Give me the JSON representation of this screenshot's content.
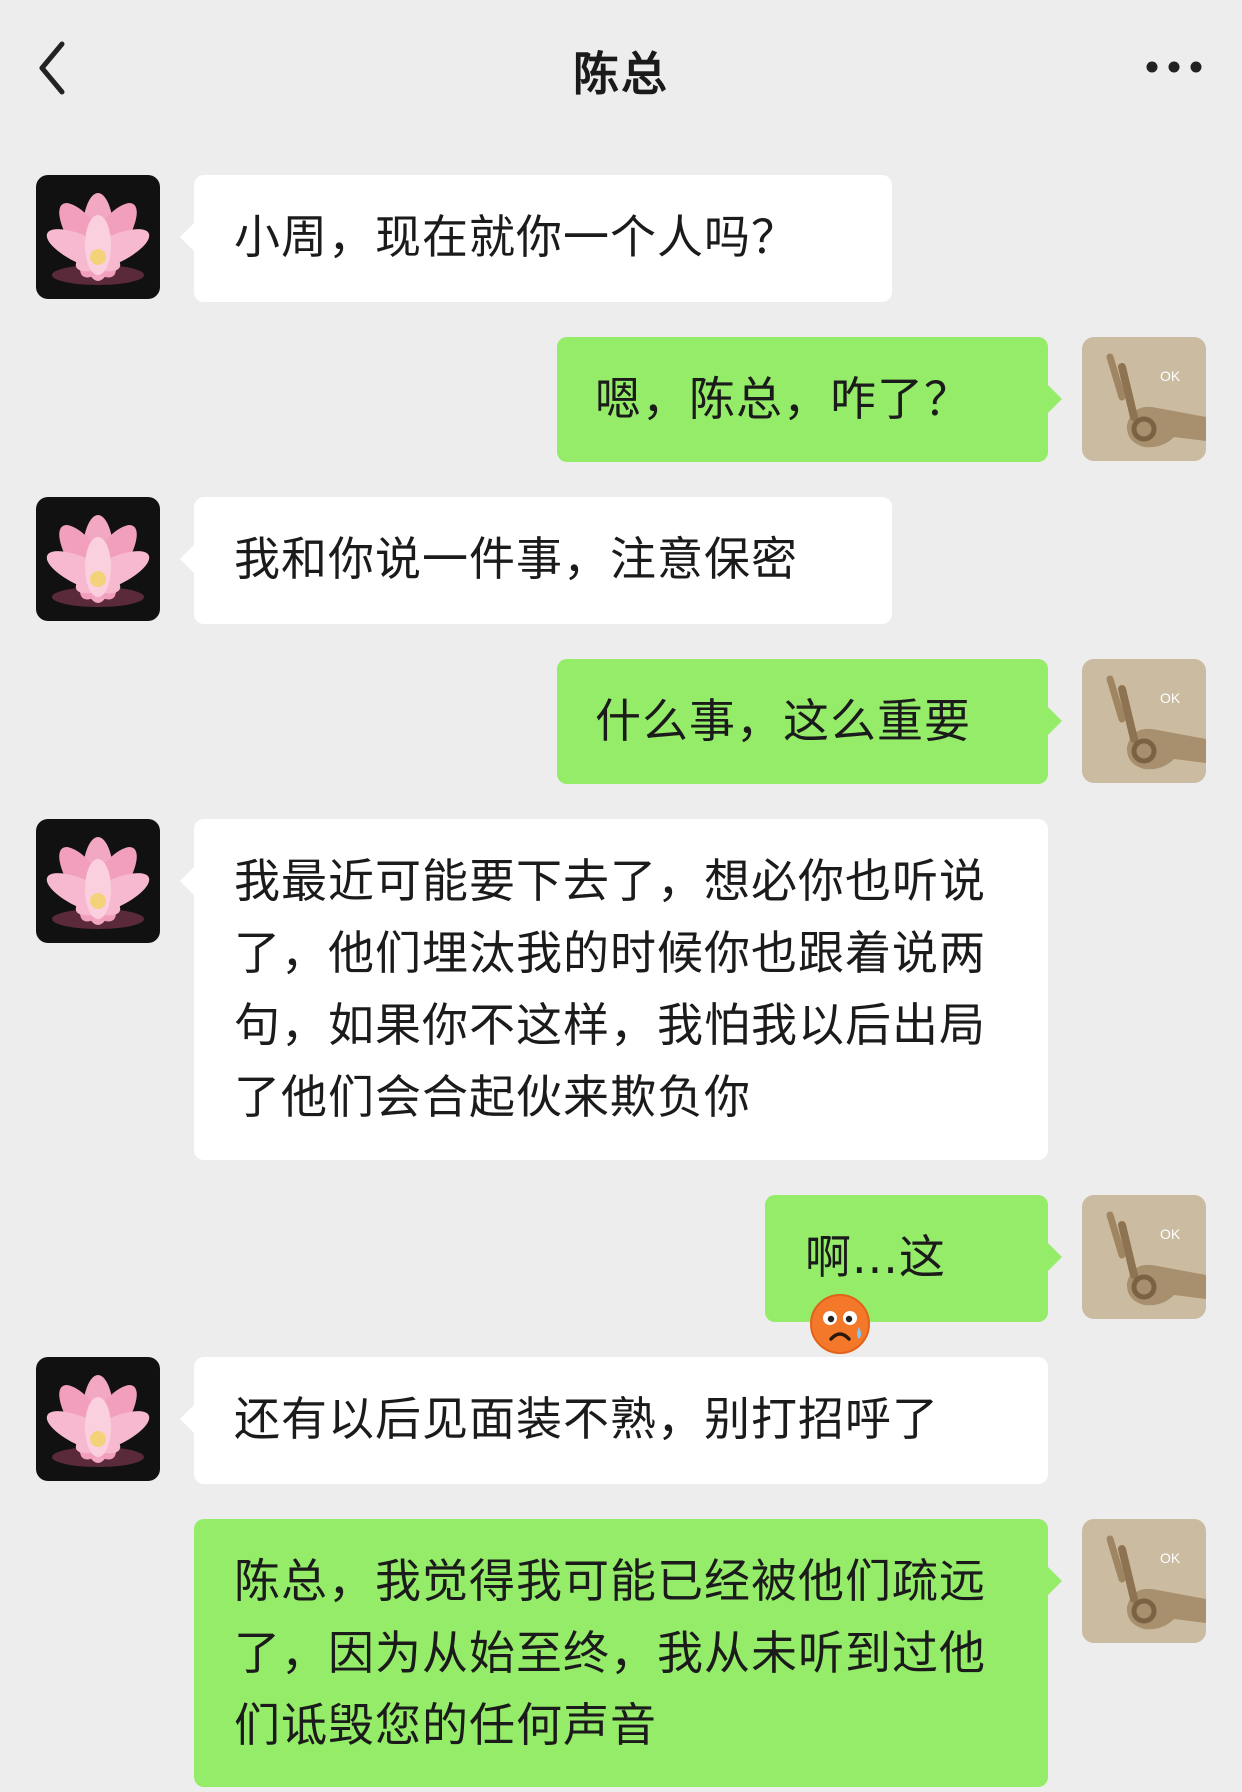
{
  "header": {
    "title": "陈总",
    "back_icon": "chevron-left-icon",
    "more_icon": "more-dots-icon"
  },
  "contact_avatar_icon": "lotus-avatar",
  "my_avatar_icon": "ok-hand-avatar",
  "my_avatar_label": "OK",
  "messages": [
    {
      "from": "contact",
      "text": "小周，现在就你一个人吗？"
    },
    {
      "from": "me",
      "text": "嗯，陈总，咋了？"
    },
    {
      "from": "contact",
      "text": "我和你说一件事，注意保密"
    },
    {
      "from": "me",
      "text": "什么事，这么重要"
    },
    {
      "from": "contact",
      "text": "我最近可能要下去了，想必你也听说了，他们埋汰我的时候你也跟着说两句，如果你不这样，我怕我以后出局了他们会合起伙来欺负你"
    },
    {
      "from": "me",
      "text": "啊...这",
      "emoji": "sweat-frown-emoji"
    },
    {
      "from": "contact",
      "text": "还有以后见面装不熟，别打招呼了"
    },
    {
      "from": "me",
      "text": "陈总，我觉得我可能已经被他们疏远了，因为从始至终，我从未听到过他们诋毁您的任何声音"
    }
  ],
  "colors": {
    "background": "#ededed",
    "incoming_bubble": "#ffffff",
    "outgoing_bubble": "#95ec69"
  }
}
